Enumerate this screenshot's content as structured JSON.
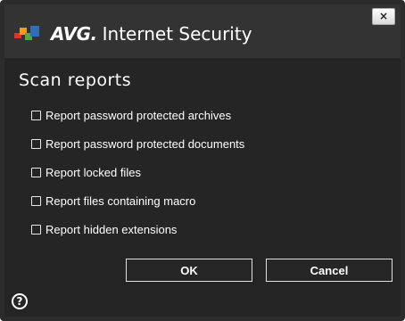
{
  "window": {
    "brand": "AVG.",
    "product": "Internet Security",
    "close_label": "×"
  },
  "section_title": "Scan reports",
  "options": [
    {
      "label": "Report password protected archives",
      "checked": false
    },
    {
      "label": "Report password protected documents",
      "checked": false
    },
    {
      "label": "Report locked files",
      "checked": false
    },
    {
      "label": "Report files containing macro",
      "checked": false
    },
    {
      "label": "Report hidden extensions",
      "checked": false
    }
  ],
  "buttons": {
    "ok": "OK",
    "cancel": "Cancel"
  },
  "help_icon": "?",
  "colors": {
    "background": "#252525",
    "titlebar": "#333333",
    "text": "#ffffff",
    "logo_red": "#e3322b",
    "logo_orange": "#f39b1f",
    "logo_green": "#4fa949",
    "logo_blue": "#2e6fb7"
  }
}
